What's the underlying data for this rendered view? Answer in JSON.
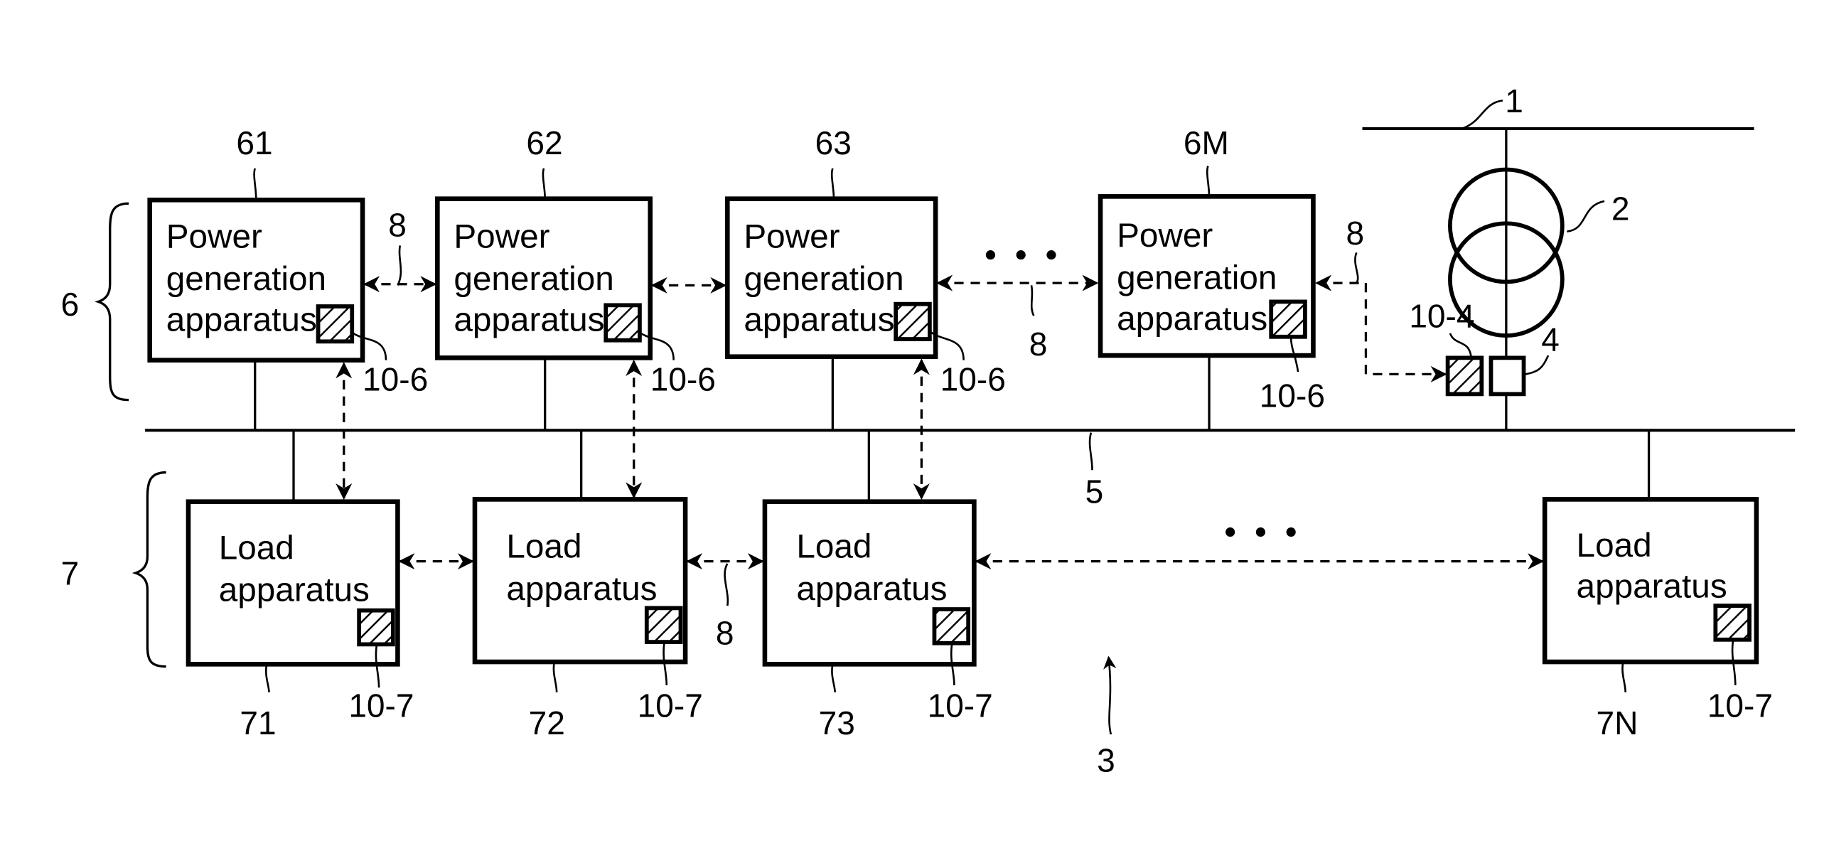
{
  "figure": {
    "system_ref": "3",
    "grid_line_ref": "1",
    "transformer_ref": "2",
    "meter_ref": "4",
    "meter_comm_ref": "10-4",
    "bus_ref": "5",
    "comm_link_ref": "8",
    "generation_group": {
      "ref": "6",
      "apparatus": [
        {
          "ref": "61",
          "line1": "Power",
          "line2": "generation",
          "line3": "apparatus",
          "comm_ref": "10-6"
        },
        {
          "ref": "62",
          "line1": "Power",
          "line2": "generation",
          "line3": "apparatus",
          "comm_ref": "10-6"
        },
        {
          "ref": "63",
          "line1": "Power",
          "line2": "generation",
          "line3": "apparatus",
          "comm_ref": "10-6"
        },
        {
          "ref": "6M",
          "line1": "Power",
          "line2": "generation",
          "line3": "apparatus",
          "comm_ref": "10-6"
        }
      ]
    },
    "load_group": {
      "ref": "7",
      "apparatus": [
        {
          "ref": "71",
          "line1": "Load",
          "line2": "apparatus",
          "comm_ref": "10-7"
        },
        {
          "ref": "72",
          "line1": "Load",
          "line2": "apparatus",
          "comm_ref": "10-7"
        },
        {
          "ref": "73",
          "line1": "Load",
          "line2": "apparatus",
          "comm_ref": "10-7"
        },
        {
          "ref": "7N",
          "line1": "Load",
          "line2": "apparatus",
          "comm_ref": "10-7"
        }
      ]
    },
    "ellipsis": "..."
  }
}
